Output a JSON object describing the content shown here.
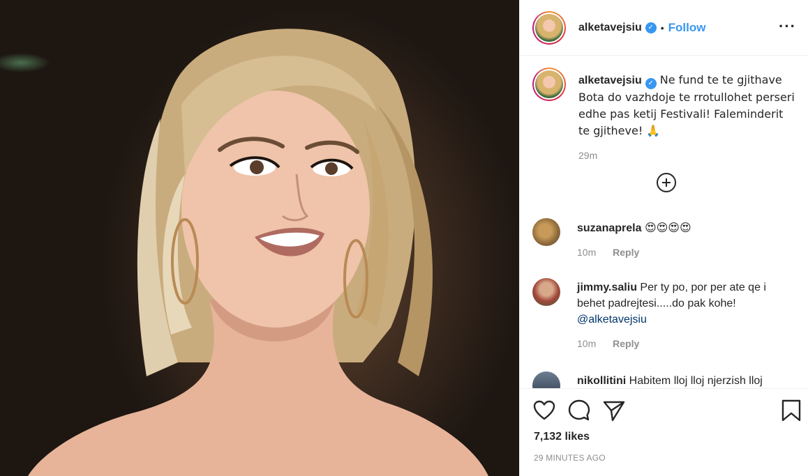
{
  "post": {
    "author": "alketavejsiu",
    "follow_label": "Follow",
    "more_icon": "more-options-icon",
    "caption": {
      "username": "alketavejsiu",
      "text": "Ne fund te te gjithave Bota do vazhdoje te rrotullohet perseri edhe pas ketij Festivali! Faleminderit te gjitheve! 🙏",
      "age": "29m"
    },
    "load_more_icon": "plus-circle-icon",
    "comments": [
      {
        "username": "suzanaprela",
        "text": "😍😍😍😍",
        "age": "10m",
        "reply_label": "Reply"
      },
      {
        "username": "jimmy.saliu",
        "text": "Per ty po, por per ate qe i behet padrejtesi.....do pak kohe! ",
        "mention": "@alketavejsiu",
        "age": "10m",
        "reply_label": "Reply"
      },
      {
        "username": "nikollitini",
        "text": "Habitem lloj lloj njerzish lloj"
      }
    ],
    "likes": "7,132 likes",
    "timestamp": "29 MINUTES AGO",
    "icons": {
      "like": "heart-icon",
      "comment": "comment-icon",
      "share": "share-icon",
      "save": "bookmark-icon",
      "verified": "verified-badge-icon"
    },
    "colors": {
      "link": "#3897f0",
      "text": "#262626",
      "muted": "#8e8e8e",
      "mention": "#003569"
    }
  }
}
